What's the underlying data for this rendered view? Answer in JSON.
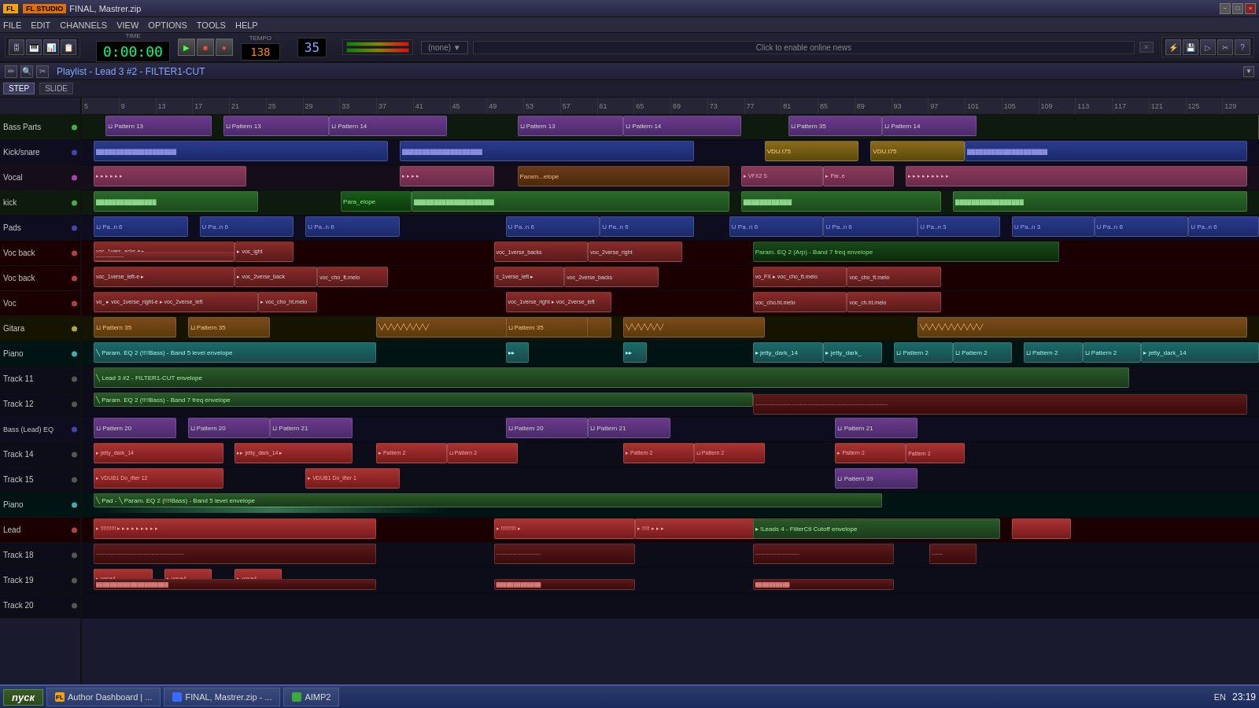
{
  "titlebar": {
    "logo": "FL",
    "studio": "FL STUDIO",
    "filename": "FINAL, Mastrer.zip",
    "win_controls": [
      "-",
      "□",
      "×"
    ]
  },
  "menubar": {
    "items": [
      "FILE",
      "EDIT",
      "CHANNELS",
      "VIEW",
      "OPTIONS",
      "TOOLS",
      "HELP"
    ]
  },
  "transport": {
    "time": "0:00:00",
    "bpm": "138",
    "tempo_label": "TEMPO",
    "pattern_num": "35",
    "play_label": "▶",
    "stop_label": "■",
    "record_label": "●"
  },
  "playlist": {
    "title": "Playlist - Lead 3 #2 - FILTER1-CUT",
    "step_label": "STEP",
    "slide_label": "SLIDE",
    "news_text": "Click to enable online news"
  },
  "tracks": [
    {
      "id": "bass-parts",
      "name": "Bass Parts",
      "color": "green",
      "height": 32
    },
    {
      "id": "kick-snare",
      "name": "Kick/snare",
      "color": "blue",
      "height": 32
    },
    {
      "id": "vocal",
      "name": "Vocal",
      "color": "purple",
      "height": 32
    },
    {
      "id": "kick",
      "name": "kick",
      "color": "green",
      "height": 32
    },
    {
      "id": "pads",
      "name": "Pads",
      "color": "blue",
      "height": 32
    },
    {
      "id": "voc-back-1",
      "name": "Voc back",
      "color": "red",
      "height": 32
    },
    {
      "id": "voc-back-2",
      "name": "Voc back",
      "color": "red",
      "height": 32
    },
    {
      "id": "voc",
      "name": "Voc",
      "color": "red",
      "height": 32
    },
    {
      "id": "gitara",
      "name": "Gitara",
      "color": "olive",
      "height": 32
    },
    {
      "id": "piano-1",
      "name": "Piano",
      "color": "teal",
      "height": 32
    },
    {
      "id": "track11",
      "name": "Track 11",
      "color": "default",
      "height": 32
    },
    {
      "id": "track12",
      "name": "Track 12",
      "color": "default",
      "height": 32
    },
    {
      "id": "bass-lead-eq",
      "name": "Bass (Lead) EQ",
      "color": "blue",
      "height": 32
    },
    {
      "id": "track14",
      "name": "Track 14",
      "color": "default",
      "height": 32
    },
    {
      "id": "track15",
      "name": "Track 15",
      "color": "default",
      "height": 32
    },
    {
      "id": "piano-2",
      "name": "Piano",
      "color": "teal",
      "height": 32
    },
    {
      "id": "lead",
      "name": "Lead",
      "color": "red",
      "height": 32
    },
    {
      "id": "track18",
      "name": "Track 18",
      "color": "default",
      "height": 32
    },
    {
      "id": "track19",
      "name": "Track 19",
      "color": "default",
      "height": 32
    },
    {
      "id": "track20",
      "name": "Track 20",
      "color": "default",
      "height": 32
    }
  ],
  "ruler": {
    "ticks": [
      "5",
      "9",
      "13",
      "17",
      "21",
      "25",
      "29",
      "33",
      "37",
      "41",
      "45",
      "49",
      "53",
      "57",
      "61",
      "65",
      "69",
      "73",
      "77",
      "81",
      "85",
      "89",
      "93",
      "97",
      "101",
      "105",
      "109",
      "113",
      "117",
      "121",
      "125",
      "129"
    ]
  },
  "taskbar": {
    "start_label": "пуск",
    "items": [
      {
        "icon": "fl-icon",
        "label": "Author Dashboard | ..."
      },
      {
        "icon": "file-icon",
        "label": "FINAL, Mastrer.zip - ..."
      },
      {
        "icon": "aimp-icon",
        "label": "AIMP2"
      }
    ],
    "sys": {
      "lang": "EN",
      "time": "23:19"
    }
  }
}
